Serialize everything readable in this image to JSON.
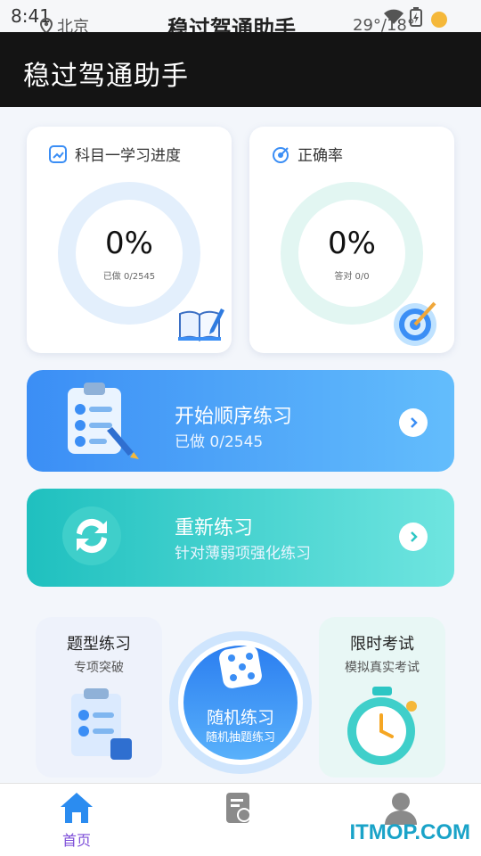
{
  "status_bar": {
    "time": "8:41",
    "location": "北京",
    "app_name": "稳过驾通助手",
    "weather": "29°/18°"
  },
  "header": {
    "title": "稳过驾通助手"
  },
  "progress_card": {
    "title": "科目一学习进度",
    "percent": "0%",
    "detail": "已做 0/2545",
    "progress": 0
  },
  "accuracy_card": {
    "title": "正确率",
    "percent": "0%",
    "detail": "答对 0/0",
    "progress": 0
  },
  "sequential": {
    "title": "开始顺序练习",
    "subtitle": "已做 0/2545"
  },
  "redo": {
    "title": "重新练习",
    "subtitle": "针对薄弱项强化练习"
  },
  "type_practice": {
    "title": "题型练习",
    "subtitle": "专项突破"
  },
  "random_practice": {
    "title": "随机练习",
    "subtitle": "随机抽题练习"
  },
  "exam": {
    "title": "限时考试",
    "subtitle": "模拟真实考试"
  },
  "tabbar": {
    "home_label": "首页"
  },
  "watermark": "ITMOP.COM",
  "colors": {
    "accent": "#3b8ef5",
    "teal": "#2cc6c4",
    "tab_active": "#7c4dd8"
  }
}
